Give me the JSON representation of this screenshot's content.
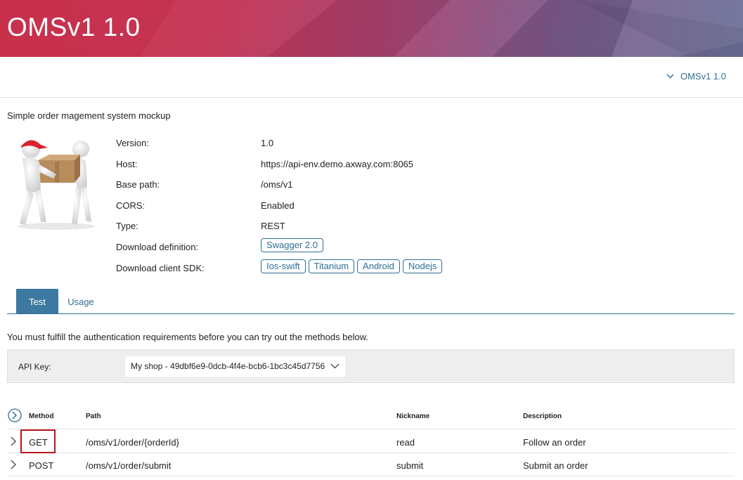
{
  "app": {
    "title": "OMSv1 1.0"
  },
  "subnav": {
    "api_selector": "OMSv1 1.0"
  },
  "description": "Simple order magement system mockup",
  "info": {
    "version_label": "Version:",
    "version": "1.0",
    "host_label": "Host:",
    "host": "https://api-env.demo.axway.com:8065",
    "base_path_label": "Base path:",
    "base_path": "/oms/v1",
    "cors_label": "CORS:",
    "cors": "Enabled",
    "type_label": "Type:",
    "type": "REST",
    "download_definition_label": "Download definition:",
    "download_definition": [
      "Swagger 2.0"
    ],
    "download_sdk_label": "Download client SDK:",
    "sdks": [
      "Ios-swift",
      "Titanium",
      "Android",
      "Nodejs"
    ]
  },
  "tabs": [
    {
      "label": "Test",
      "active": true
    },
    {
      "label": "Usage",
      "active": false
    }
  ],
  "auth_message": "You must fulfill the authentication requirements before you can try out the methods below.",
  "api_key": {
    "label": "API Key:",
    "selected": "My shop - 49dbf6e9-0dcb-4f4e-bcb6-1bc3c45d7756"
  },
  "methods_table": {
    "columns": [
      "Method",
      "Path",
      "Nickname",
      "Description"
    ],
    "rows": [
      {
        "method": "GET",
        "path": "/oms/v1/order/{orderId}",
        "nickname": "read",
        "description": "Follow an order"
      },
      {
        "method": "POST",
        "path": "/oms/v1/order/submit",
        "nickname": "submit",
        "description": "Submit an order"
      }
    ]
  },
  "colors": {
    "accent": "#2f6f94",
    "active_tab": "#3d78a0",
    "highlight": "#b1161e"
  }
}
